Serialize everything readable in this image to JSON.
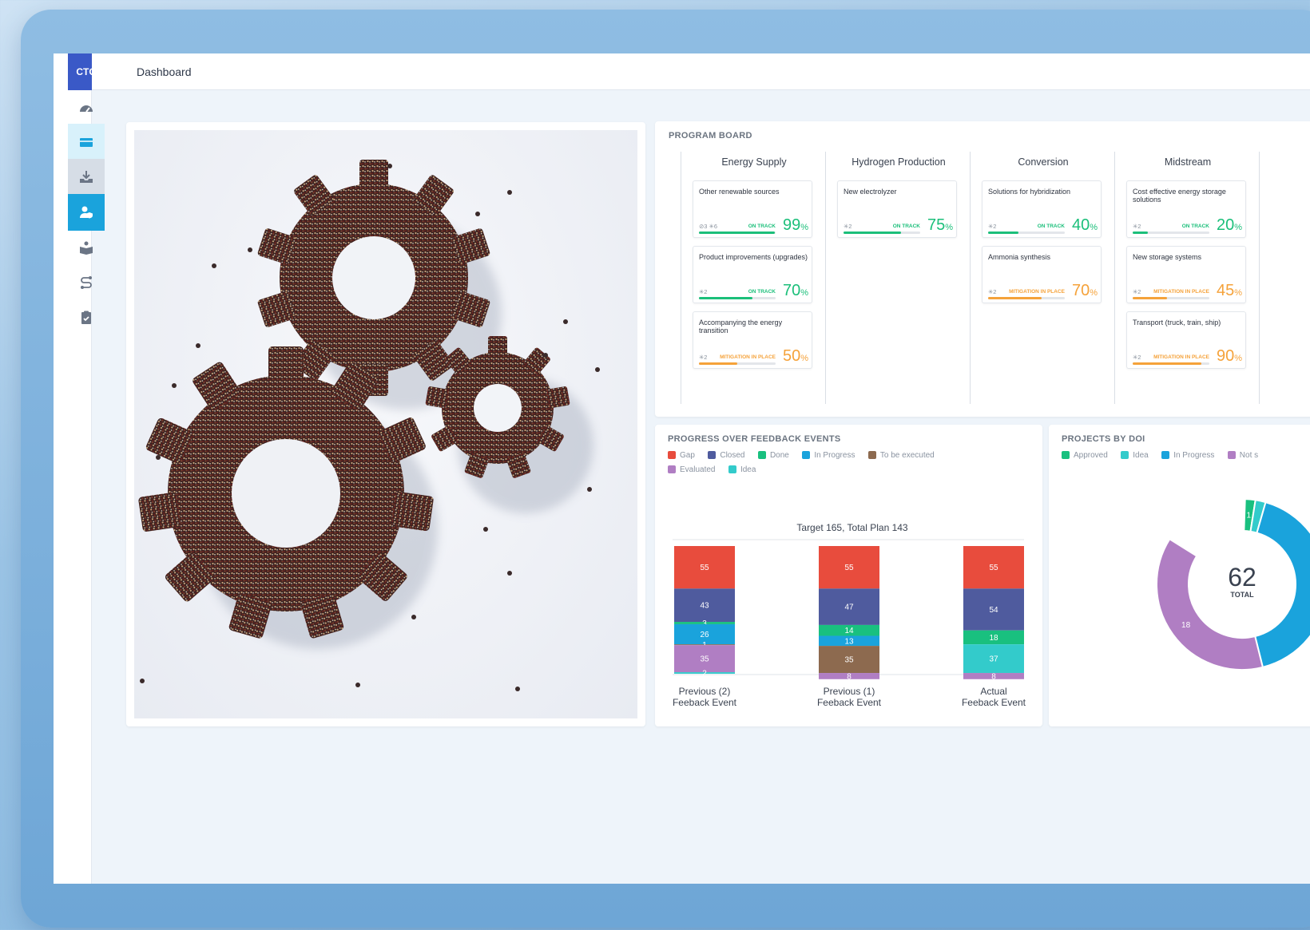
{
  "app": {
    "logo": "CTG",
    "title": "Dashboard"
  },
  "sidebar": {
    "items": [
      {
        "icon": "speedometer-icon",
        "active": false
      },
      {
        "icon": "boxes-icon",
        "active": true
      },
      {
        "icon": "inbox-download-icon",
        "active": false
      },
      {
        "icon": "user-shield-icon",
        "active": true
      },
      {
        "icon": "book-user-icon",
        "active": false
      },
      {
        "icon": "route-icon",
        "active": false
      },
      {
        "icon": "clipboard-check-icon",
        "active": false
      }
    ]
  },
  "program_board": {
    "title": "PROGRAM BOARD",
    "columns": [
      {
        "name": "Energy Supply",
        "cards": [
          {
            "title": "Other renewable sources",
            "meta": "⊘3  ✳6",
            "status": "ON TRACK",
            "pct": "99",
            "color": "#1bbf7a"
          },
          {
            "title": "Product improvements (upgrades)",
            "meta": "✳2",
            "status": "ON TRACK",
            "pct": "70",
            "color": "#1bbf7a"
          },
          {
            "title": "Accompanying the energy transition",
            "meta": "✳2",
            "status": "MITIGATION IN PLACE",
            "pct": "50",
            "color": "#f5a23a"
          }
        ]
      },
      {
        "name": "Hydrogen Production",
        "cards": [
          {
            "title": "New electrolyzer",
            "meta": "✳2",
            "status": "ON TRACK",
            "pct": "75",
            "color": "#1bbf7a"
          }
        ]
      },
      {
        "name": "Conversion",
        "cards": [
          {
            "title": "Solutions for hybridization",
            "meta": "✳2",
            "status": "ON TRACK",
            "pct": "40",
            "color": "#1bbf7a"
          },
          {
            "title": "Ammonia synthesis",
            "meta": "✳2",
            "status": "MITIGATION IN PLACE",
            "pct": "70",
            "color": "#f5a23a"
          }
        ]
      },
      {
        "name": "Midstream",
        "cards": [
          {
            "title": "Cost effective energy storage solutions",
            "meta": "✳2",
            "status": "ON TRACK",
            "pct": "20",
            "color": "#1bbf7a"
          },
          {
            "title": "New storage systems",
            "meta": "✳2",
            "status": "MITIGATION IN PLACE",
            "pct": "45",
            "color": "#f5a23a"
          },
          {
            "title": "Transport (truck, train, ship)",
            "meta": "✳2",
            "status": "MITIGATION IN PLACE",
            "pct": "90",
            "color": "#f5a23a"
          }
        ]
      }
    ]
  },
  "progress": {
    "title": "PROGRESS OVER FEEDBACK EVENTS",
    "legend": [
      {
        "label": "Gap",
        "color": "#e84c3d"
      },
      {
        "label": "Closed",
        "color": "#4f5b9e"
      },
      {
        "label": "Done",
        "color": "#19c07f"
      },
      {
        "label": "In Progress",
        "color": "#1aa3dc"
      },
      {
        "label": "To be executed",
        "color": "#8d6a4f"
      },
      {
        "label": "Evaluated",
        "color": "#b07ec3"
      },
      {
        "label": "Idea",
        "color": "#33cbcb"
      }
    ]
  },
  "doi": {
    "title": "PROJECTS BY DOI",
    "legend": [
      {
        "label": "Approved",
        "color": "#19c07f"
      },
      {
        "label": "Idea",
        "color": "#33cbcb"
      },
      {
        "label": "In Progress",
        "color": "#1aa3dc"
      },
      {
        "label": "Not s",
        "color": "#b07ec3"
      }
    ],
    "total_value": "62",
    "total_label": "TOTAL"
  },
  "chart_data": [
    {
      "type": "bar",
      "title": "Target 165, Total Plan 143",
      "categories": [
        "Previous (2) Feeback Event",
        "Previous (1) Feeback Event",
        "Actual Feeback Event"
      ],
      "category_lines": [
        [
          "Previous (2)",
          "Feeback Event"
        ],
        [
          "Previous (1)",
          "Feeback Event"
        ],
        [
          "Actual",
          "Feeback Event"
        ]
      ],
      "stacked": true,
      "series": [
        {
          "name": "Gap",
          "color": "#e84c3d",
          "values": [
            55,
            55,
            55
          ]
        },
        {
          "name": "Closed",
          "color": "#4f5b9e",
          "values": [
            43,
            47,
            54
          ]
        },
        {
          "name": "Done",
          "color": "#19c07f",
          "values": [
            3,
            14,
            18
          ]
        },
        {
          "name": "In Progress",
          "color": "#1aa3dc",
          "values": [
            26,
            13,
            0
          ]
        },
        {
          "name": "To be executed",
          "color": "#8d6a4f",
          "values": [
            1,
            35,
            0
          ]
        },
        {
          "name": "Evaluated",
          "color": "#b07ec3",
          "values": [
            35,
            8,
            8
          ]
        },
        {
          "name": "Idea",
          "color": "#33cbcb",
          "values": [
            2,
            0,
            37
          ]
        }
      ],
      "bar_order": [
        [
          "Gap",
          "Closed",
          "Done",
          "In Progress",
          "To be executed",
          "Evaluated",
          "Idea"
        ],
        [
          "Gap",
          "Closed",
          "Done",
          "In Progress",
          "To be executed",
          "Evaluated"
        ],
        [
          "Gap",
          "Closed",
          "Done",
          "Idea",
          "Evaluated"
        ]
      ],
      "ylim": [
        0,
        165
      ]
    },
    {
      "type": "pie",
      "title": "PROJECTS BY DOI",
      "total": 62,
      "slices": [
        {
          "name": "Approved",
          "value": 1,
          "color": "#19c07f",
          "label": "1"
        },
        {
          "name": "Idea",
          "value": 1,
          "color": "#33cbcb",
          "label": ""
        },
        {
          "name": "In Progress",
          "value": 20,
          "color": "#1aa3dc",
          "label": ""
        },
        {
          "name": "Not s",
          "value": 18,
          "color": "#b07ec3",
          "label": "18"
        }
      ]
    }
  ]
}
